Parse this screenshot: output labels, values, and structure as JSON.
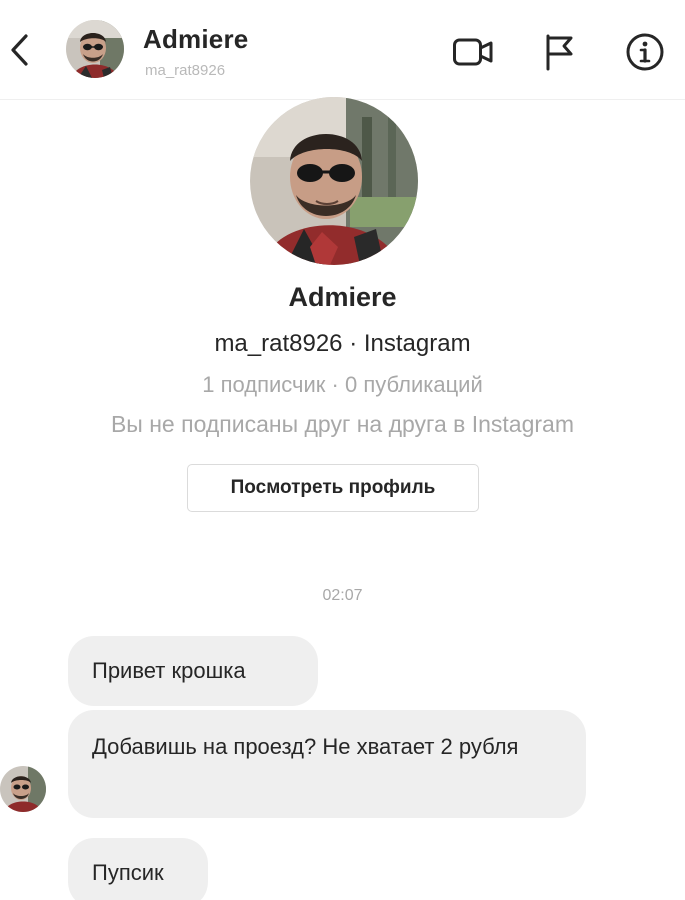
{
  "header": {
    "name": "Admiere",
    "username": "ma_rat8926",
    "icons": [
      "back-chevron-icon",
      "video-camera-icon",
      "flag-icon",
      "info-icon"
    ]
  },
  "profile": {
    "name": "Admiere",
    "subtitle": "ma_rat8926 · Instagram",
    "stats": "1 подписчик · 0 публикаций",
    "note": "Вы не подписаны друг на друга в Instagram",
    "view_profile_label": "Посмотреть профиль"
  },
  "chat": {
    "timestamp": "02:07",
    "messages": [
      {
        "text": "Привет крошка"
      },
      {
        "text": "Добавишь на проезд? Не хватает 2 рубля"
      },
      {
        "text": "Пупсик"
      }
    ]
  },
  "colors": {
    "bubble": "#efefef",
    "text_primary": "#262626",
    "text_secondary": "#a8a8a8",
    "divider": "#efefef"
  }
}
